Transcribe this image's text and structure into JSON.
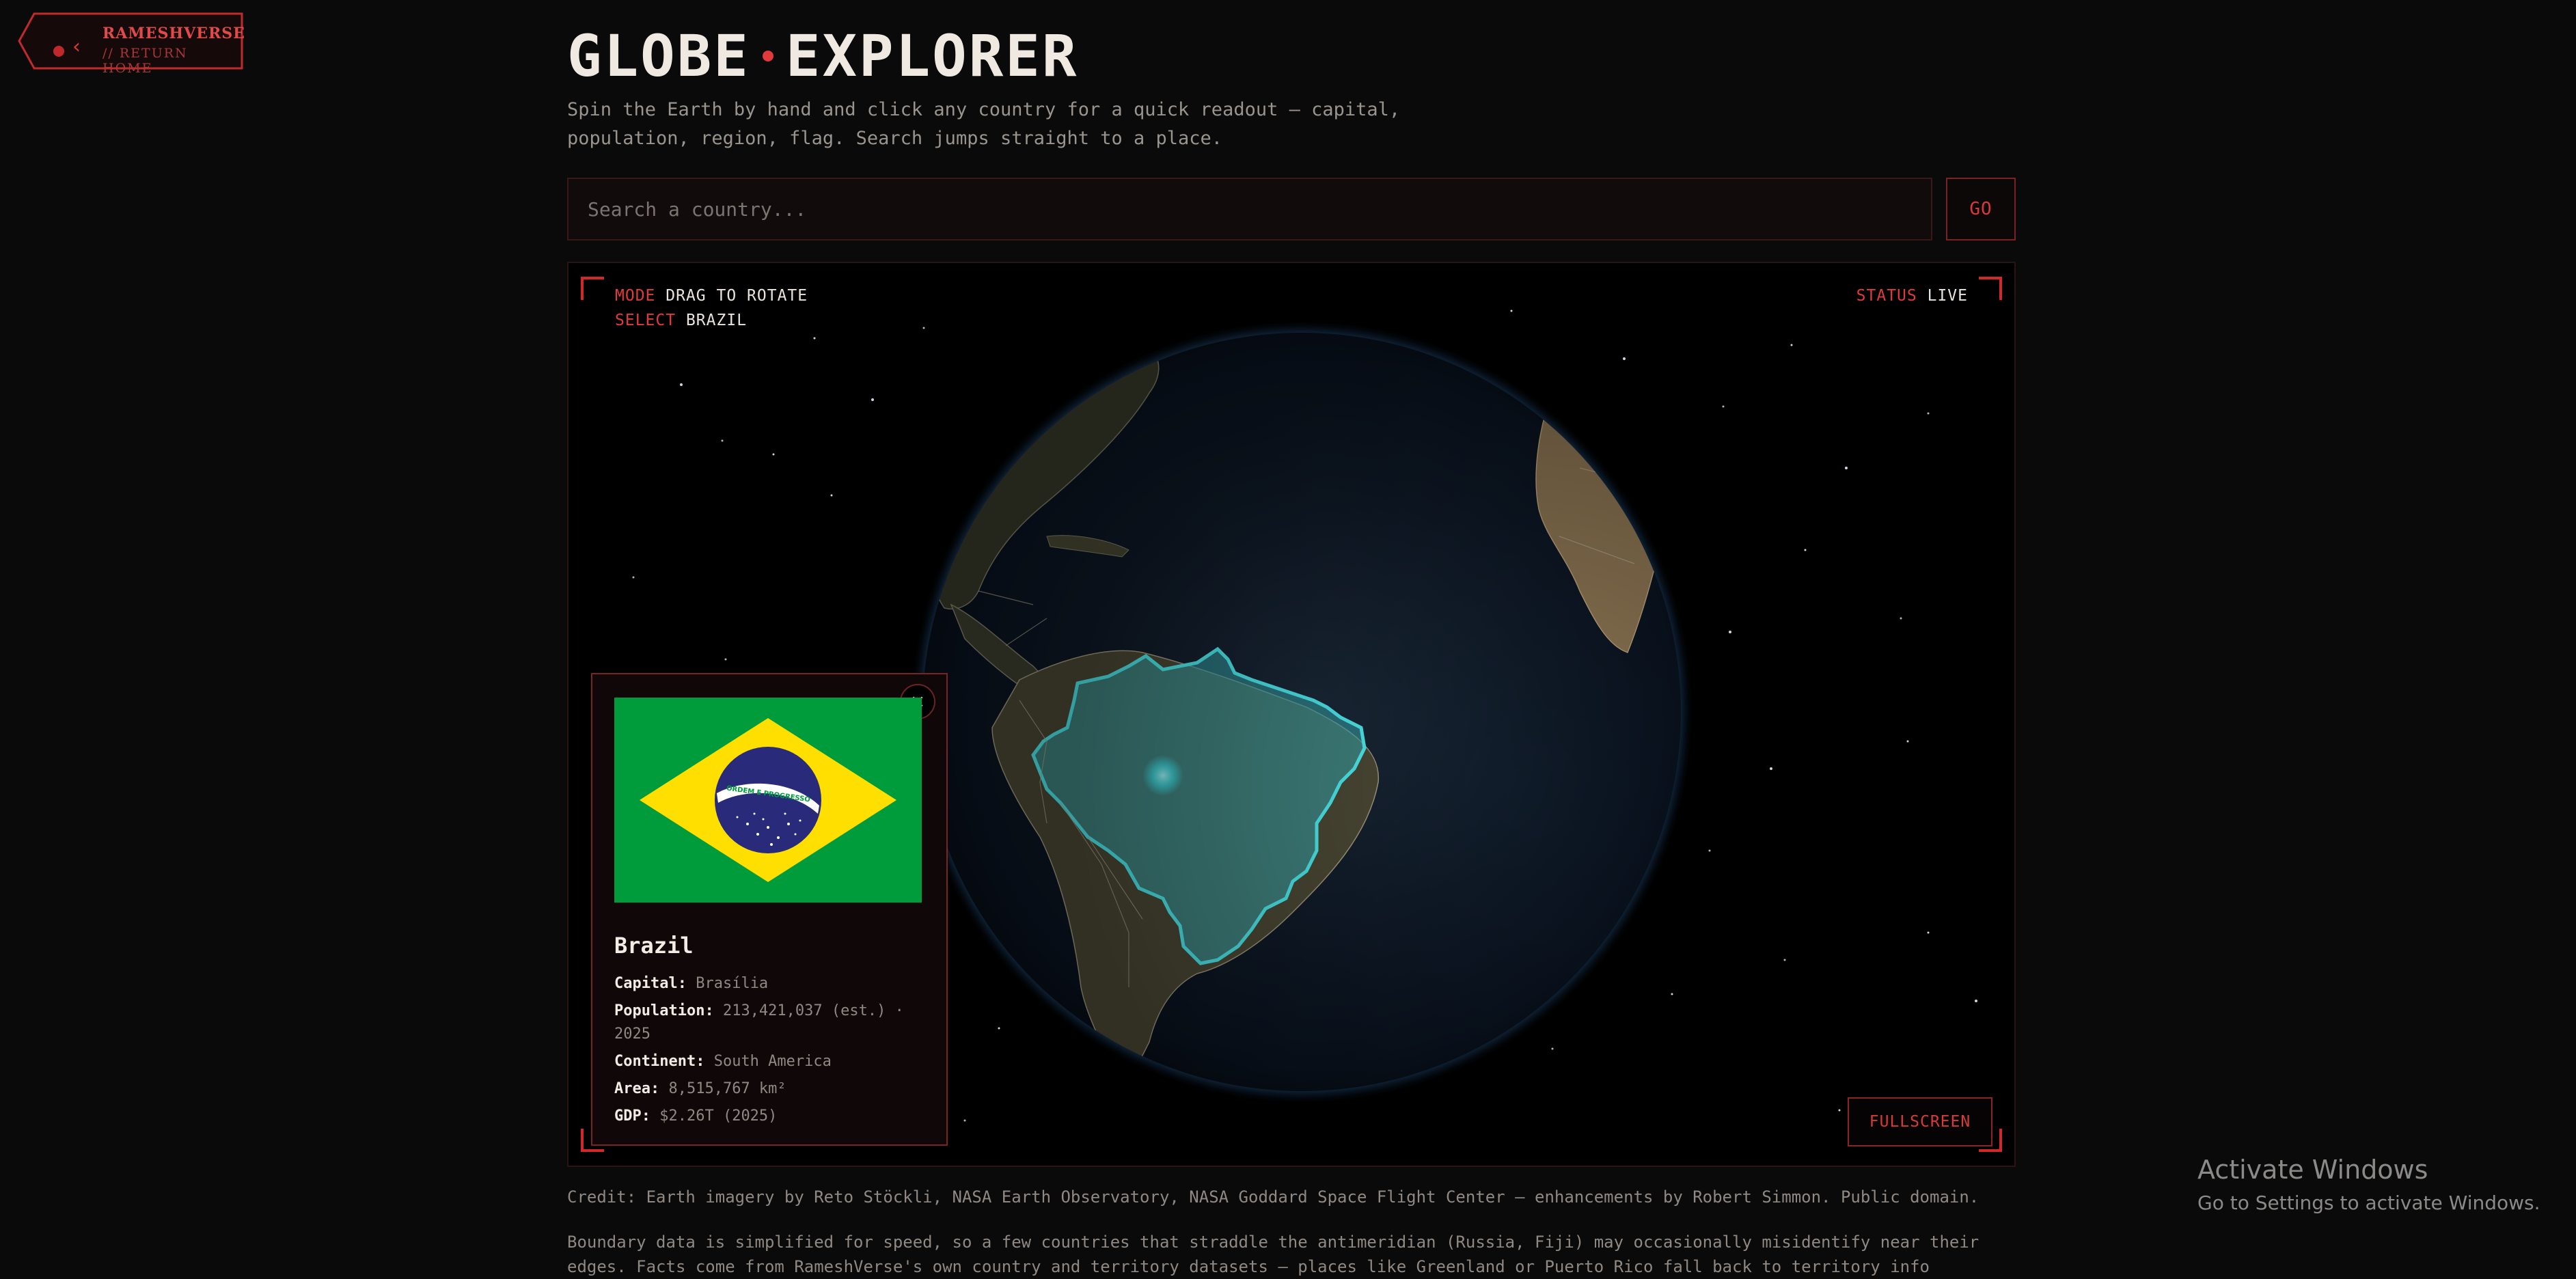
{
  "back_link": {
    "title": "RAMESHVERSE",
    "subtitle": "// RETURN HOME"
  },
  "header": {
    "title_left": "GLOBE",
    "title_right": "EXPLORER",
    "description": "Spin the Earth by hand and click any country for a quick readout — capital, population, region, flag. Search jumps straight to a place."
  },
  "search": {
    "placeholder": "Search a country...",
    "value": "",
    "go_label": "GO"
  },
  "hud": {
    "mode_key": "MODE",
    "mode_value": "DRAG TO ROTATE",
    "select_key": "SELECT",
    "select_value": "BRAZIL",
    "status_key": "STATUS",
    "status_value": "LIVE"
  },
  "fullscreen_label": "FULLSCREEN",
  "country": {
    "name": "Brazil",
    "flag_motto": "ORDEM E PROGRESSO",
    "facts": [
      {
        "label": "Capital:",
        "value": "Brasília"
      },
      {
        "label": "Population:",
        "value": "213,421,037 (est.) · 2025"
      },
      {
        "label": "Continent:",
        "value": "South America"
      },
      {
        "label": "Area:",
        "value": "8,515,767 km²"
      },
      {
        "label": "GDP:",
        "value": "$2.26T (2025)"
      }
    ],
    "close_label": "×"
  },
  "credit": "Credit: Earth imagery by Reto Stöckli, NASA Earth Observatory, NASA Goddard Space Flight Center — enhancements by Robert Simmon. Public domain.",
  "note": "Boundary data is simplified for speed, so a few countries that straddle the antimeridian (Russia, Fiji) may occasionally misidentify near their edges. Facts come from RameshVerse's own country and territory datasets — places like Greenland or Puerto Rico fall back to territory info",
  "os_watermark": {
    "line1": "Activate Windows",
    "line2": "Go to Settings to activate Windows."
  },
  "colors": {
    "accent": "#e03a3a",
    "highlight": "#3fd6d6",
    "background": "#0a0a0a"
  }
}
